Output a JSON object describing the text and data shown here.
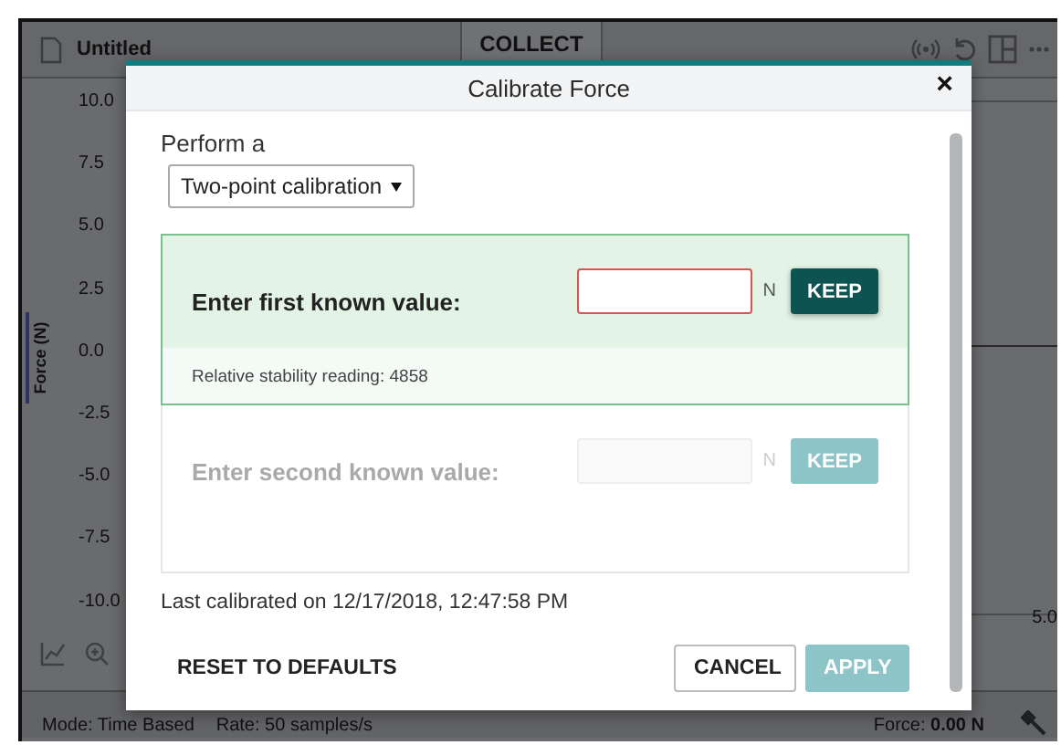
{
  "app": {
    "title": "Untitled",
    "collect_button": "COLLECT",
    "y_axis_label": "Force (N)",
    "y_ticks": [
      "10.0",
      "7.5",
      "5.0",
      "2.5",
      "0.0",
      "-2.5",
      "-5.0",
      "-7.5",
      "-10.0"
    ],
    "x_tick": "5.0",
    "status_bar": {
      "mode": "Mode: Time Based",
      "rate": "Rate: 50 samples/s",
      "force_label": "Force:",
      "force_value": "0.00 N"
    }
  },
  "dialog": {
    "title": "Calibrate Force",
    "close": "×",
    "method_label": "Perform a",
    "method": "Two-point calibration",
    "steps": [
      {
        "prompt": "Enter first known value:",
        "unit": "N",
        "button": "KEEP",
        "disabled": false,
        "invalid": true,
        "stability": "Relative stability reading: 4858"
      },
      {
        "prompt": "Enter second known value:",
        "unit": "N",
        "button": "KEEP",
        "disabled": true,
        "invalid": false
      }
    ],
    "last_calibrated": "Last calibrated on 12/17/2018, 12:47:58 PM",
    "buttons": [
      {
        "label": "RESET TO DEFAULTS",
        "kind": "text",
        "disabled": false
      },
      {
        "label": "CANCEL",
        "kind": "outlined",
        "disabled": false
      },
      {
        "label": "APPLY",
        "kind": "primary",
        "disabled": true
      }
    ]
  }
}
